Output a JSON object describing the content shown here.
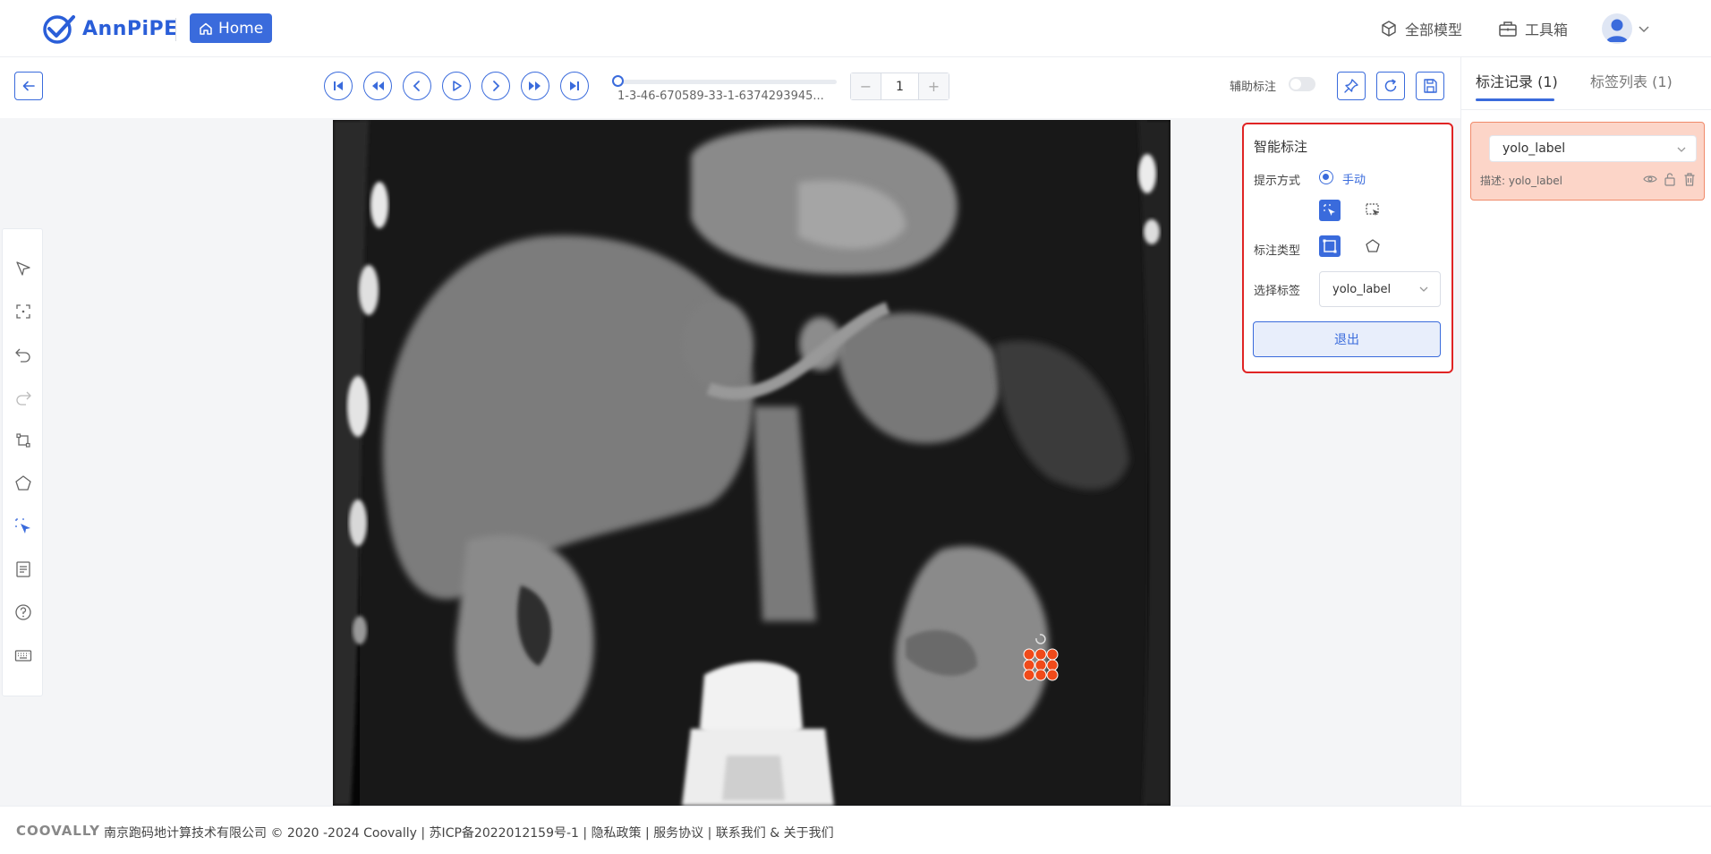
{
  "header": {
    "logo_text": "AnnPiPE",
    "home_label": "Home",
    "nav": [
      {
        "label": "全部模型",
        "icon": "cube-icon"
      },
      {
        "label": "工具箱",
        "icon": "toolbox-icon"
      }
    ]
  },
  "toolbar": {
    "file_name": "1-3-46-670589-33-1-6374293945...",
    "page_number": "1",
    "stepper_minus": "−",
    "stepper_plus": "+",
    "assist_label": "辅助标注",
    "assist_enabled": false,
    "frame_progress": 0
  },
  "smart_panel": {
    "title": "智能标注",
    "prompt_mode_label": "提示方式",
    "prompt_mode_value": "手动",
    "annotation_type_label": "标注类型",
    "select_label_label": "选择标签",
    "selected_label": "yolo_label",
    "exit_label": "退出"
  },
  "right_panel": {
    "tabs": [
      {
        "label": "标注记录 (1)",
        "active": true
      },
      {
        "label": "标签列表 (1)",
        "active": false
      }
    ],
    "records": [
      {
        "label": "yolo_label",
        "description": "描述: yolo_label"
      }
    ]
  },
  "footer": {
    "brand": "COOVALLY",
    "company": "南京跑码地计算技术有限公司 © 2020 -2024 Coovally | 苏ICP备2022012159号-1 | ",
    "privacy": "隐私政策",
    "sep1": " | ",
    "service": "服务协议",
    "sep2": " | ",
    "contact": "联系我们 & 关于我们"
  },
  "colors": {
    "accent": "#3a6bdc",
    "highlight_border": "#e02424",
    "record_bg": "#fcd5c8",
    "annotation_points": "#f04a1a"
  }
}
